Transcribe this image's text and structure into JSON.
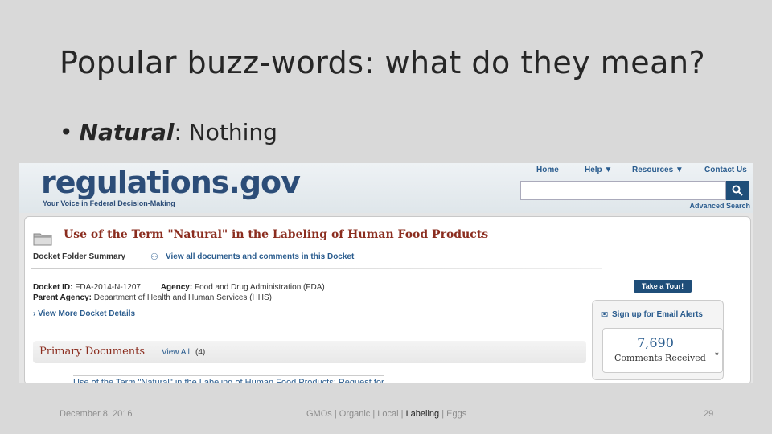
{
  "slide": {
    "title": "Popular buzz-words: what do they mean?",
    "bullet_term": "Natural",
    "bullet_colon": ":",
    "bullet_text": " Nothing"
  },
  "site": {
    "logo": "regulations.gov",
    "tagline": "Your Voice in Federal Decision-Making",
    "nav": {
      "home": "Home",
      "help": "Help",
      "resources": "Resources",
      "contact": "Contact Us"
    },
    "advanced_search": "Advanced Search"
  },
  "docket": {
    "title": "Use of the Term \"Natural\" in the Labeling of Human Food Products",
    "folder_summary": "Docket Folder Summary",
    "view_all_link": "View all documents and comments in this Docket",
    "id_label": "Docket ID:",
    "id_value": "FDA-2014-N-1207",
    "agency_label": "Agency:",
    "agency_value": "Food and Drug Administration (FDA)",
    "parent_label": "Parent Agency:",
    "parent_value": "Department of Health and Human Services (HHS)",
    "more_details": "View More Docket Details"
  },
  "primary": {
    "title": "Primary Documents",
    "view_all": "View All",
    "count": "(4)",
    "doc_link": "Use of the Term \"Natural\" in the Labeling of Human Food Products; Request for"
  },
  "sidebar": {
    "tour": "Take a Tour!",
    "email_alerts": "Sign up for Email Alerts",
    "comment_count": "7,690",
    "comment_label": "Comments Received",
    "asterisk": "*"
  },
  "footer": {
    "date": "December 8, 2016",
    "tags": [
      "GMOs",
      "Organic",
      "Local",
      "Labeling",
      "Eggs"
    ],
    "separator": " | ",
    "page": "29"
  }
}
